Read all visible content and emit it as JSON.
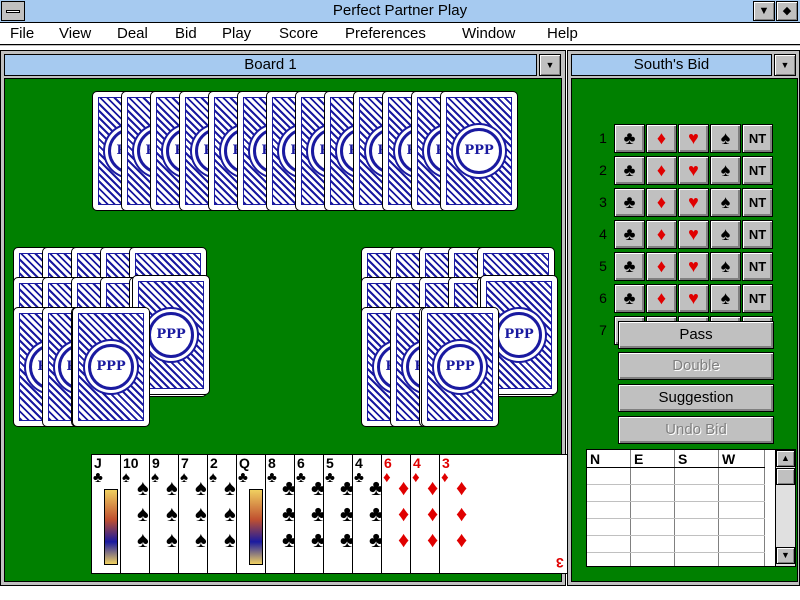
{
  "app": {
    "title": "Perfect Partner Play",
    "sysmenu_icon": "system-menu-icon",
    "minimize_icon": "▼",
    "restore_icon": "◆"
  },
  "menu": [
    "File",
    "View",
    "Deal",
    "Bid",
    "Play",
    "Score",
    "Preferences",
    "Window",
    "Help"
  ],
  "board_window": {
    "title": "Board 1",
    "dropdown_icon": "▼",
    "card_back_logo": "PPP"
  },
  "south_hand": [
    {
      "rank": "J",
      "suit": "♣",
      "color": "black"
    },
    {
      "rank": "10",
      "suit": "♠",
      "color": "black"
    },
    {
      "rank": "9",
      "suit": "♠",
      "color": "black"
    },
    {
      "rank": "7",
      "suit": "♠",
      "color": "black"
    },
    {
      "rank": "2",
      "suit": "♠",
      "color": "black"
    },
    {
      "rank": "Q",
      "suit": "♣",
      "color": "black"
    },
    {
      "rank": "8",
      "suit": "♣",
      "color": "black"
    },
    {
      "rank": "6",
      "suit": "♣",
      "color": "black"
    },
    {
      "rank": "5",
      "suit": "♣",
      "color": "black"
    },
    {
      "rank": "4",
      "suit": "♣",
      "color": "black"
    },
    {
      "rank": "6",
      "suit": "♦",
      "color": "red"
    },
    {
      "rank": "4",
      "suit": "♦",
      "color": "red"
    },
    {
      "rank": "3",
      "suit": "♦",
      "color": "red"
    }
  ],
  "bid_window": {
    "title": "South's Bid",
    "dropdown_icon": "▼",
    "levels": [
      "1",
      "2",
      "3",
      "4",
      "5",
      "6",
      "7"
    ],
    "strains": [
      {
        "symbol": "♣",
        "color": "black"
      },
      {
        "symbol": "♦",
        "color": "red"
      },
      {
        "symbol": "♥",
        "color": "red"
      },
      {
        "symbol": "♠",
        "color": "black"
      },
      {
        "symbol": "NT",
        "color": "black"
      }
    ],
    "pass_label": "Pass",
    "double_label": "Double",
    "suggestion_label": "Suggestion",
    "undo_label": "Undo Bid",
    "auction_headers": [
      "N",
      "E",
      "S",
      "W"
    ],
    "scroll_up_icon": "▲",
    "scroll_down_icon": "▼"
  }
}
